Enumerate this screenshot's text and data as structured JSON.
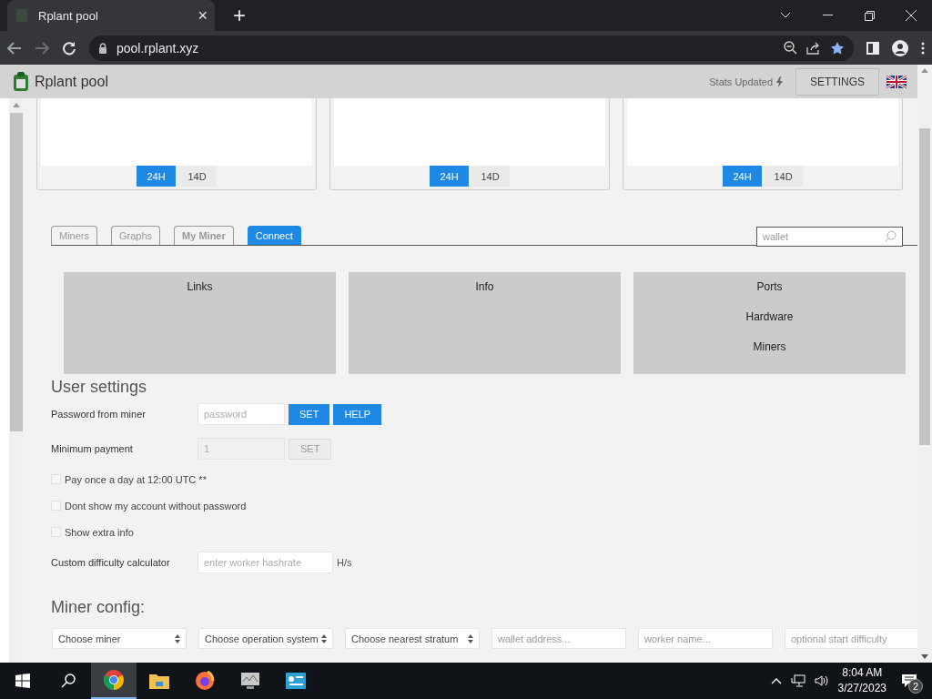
{
  "browser": {
    "tab_title": "Rplant pool",
    "tab_close": "×",
    "new_tab": "+",
    "address": "pool.rplant.xyz",
    "bookmarked": true
  },
  "header": {
    "site_name": "Rplant pool",
    "stats_label": "Stats Updated",
    "settings_button": "SETTINGS"
  },
  "charts": [
    {
      "periods": [
        {
          "label": "24H",
          "selected": true
        },
        {
          "label": "14D",
          "selected": false
        }
      ]
    },
    {
      "periods": [
        {
          "label": "24H",
          "selected": true
        },
        {
          "label": "14D",
          "selected": false
        }
      ]
    },
    {
      "periods": [
        {
          "label": "24H",
          "selected": true
        },
        {
          "label": "14D",
          "selected": false
        }
      ]
    }
  ],
  "tabs": [
    {
      "label": "Miners",
      "selected": false
    },
    {
      "label": "Graphs",
      "selected": false
    },
    {
      "label": "My Miner",
      "selected": false
    },
    {
      "label": "Connect",
      "selected": true
    }
  ],
  "search": {
    "placeholder": "wallet"
  },
  "panels": [
    {
      "items": [
        "Links"
      ]
    },
    {
      "items": [
        "Info"
      ]
    },
    {
      "items": [
        "Ports",
        "Hardware",
        "Miners"
      ]
    }
  ],
  "user_settings": {
    "title": "User settings",
    "rows": [
      {
        "kind": "input",
        "label": "Password from miner",
        "placeholder": "password",
        "disabled": false,
        "buttons": [
          {
            "label": "SET",
            "disabled": false
          },
          {
            "label": "HELP",
            "disabled": false
          }
        ]
      },
      {
        "kind": "input",
        "label": "Minimum payment",
        "value": "1",
        "disabled": true,
        "buttons": [
          {
            "label": "SET",
            "disabled": true
          }
        ]
      },
      {
        "kind": "checkbox",
        "label": "Pay once a day at 12:00 UTC **",
        "checked": false
      },
      {
        "kind": "checkbox",
        "label": "Dont show my account without password",
        "checked": false
      },
      {
        "kind": "checkbox",
        "label": "Show extra info",
        "checked": false
      },
      {
        "kind": "input",
        "label": "Custom difficulty calculator",
        "placeholder": "enter worker hashrate",
        "disabled": false,
        "unit": "H/s"
      }
    ]
  },
  "miner_config": {
    "title": "Miner config:",
    "fields": [
      {
        "kind": "select",
        "value": "Choose miner"
      },
      {
        "kind": "select",
        "value": "Choose operation system"
      },
      {
        "kind": "select",
        "value": "Choose nearest stratum"
      },
      {
        "kind": "input",
        "placeholder": "wallet address..."
      },
      {
        "kind": "input",
        "placeholder": "worker name..."
      },
      {
        "kind": "input",
        "placeholder": "optional start difficulty"
      }
    ]
  },
  "taskbar": {
    "apps": [
      {
        "kind": "chrome",
        "selected": true
      },
      {
        "kind": "folder",
        "selected": false
      },
      {
        "kind": "firefox",
        "selected": false
      },
      {
        "kind": "monitor",
        "selected": false
      },
      {
        "kind": "panel",
        "selected": false
      }
    ],
    "time": "8:04 AM",
    "date": "3/27/2023",
    "notifications": "2"
  }
}
